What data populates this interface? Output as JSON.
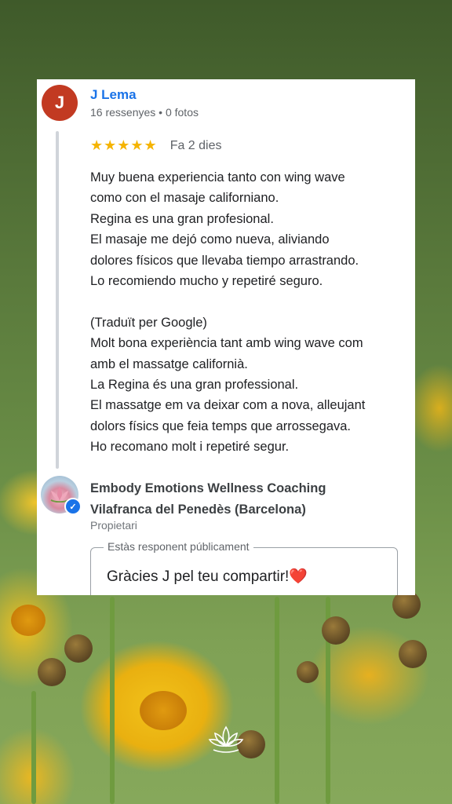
{
  "review": {
    "avatar_letter": "J",
    "reviewer_name": "J Lema",
    "reviewer_meta": "16 ressenyes • 0 fotos",
    "rating": 5,
    "stars": "★★★★★",
    "date": "Fa 2 dies",
    "lines": [
      "Muy buena experiencia tanto con wing wave",
      "como con el masaje californiano.",
      "Regina es una gran profesional.",
      "El masaje me dejó como nueva, aliviando",
      "dolores físicos que llevaba tiempo arrastrando.",
      "Lo recomiendo mucho y repetiré seguro.",
      "",
      "(Traduït per Google)",
      "Molt bona experiència tant amb wing wave com",
      "amb el massatge californià.",
      "La Regina és una gran professional.",
      "El massatge em va deixar com a nova, alleujant",
      "dolors físics que feia temps que arrossegava.",
      "Ho recomano molt i repetiré segur."
    ]
  },
  "owner": {
    "name_line1": "Embody Emotions Wellness Coaching",
    "name_line2": "Vilafranca del Penedès (Barcelona)",
    "role": "Propietari"
  },
  "reply": {
    "legend": "Estàs responent públicament",
    "text": "Gràcies J pel teu compartir!",
    "emoji": "❤️"
  },
  "colors": {
    "accent_blue": "#1a73e8",
    "avatar_red": "#c23a22",
    "star_gold": "#f5b400"
  },
  "icons": [
    "verified-badge-icon",
    "lotus-logo-icon",
    "heart-emoji"
  ]
}
